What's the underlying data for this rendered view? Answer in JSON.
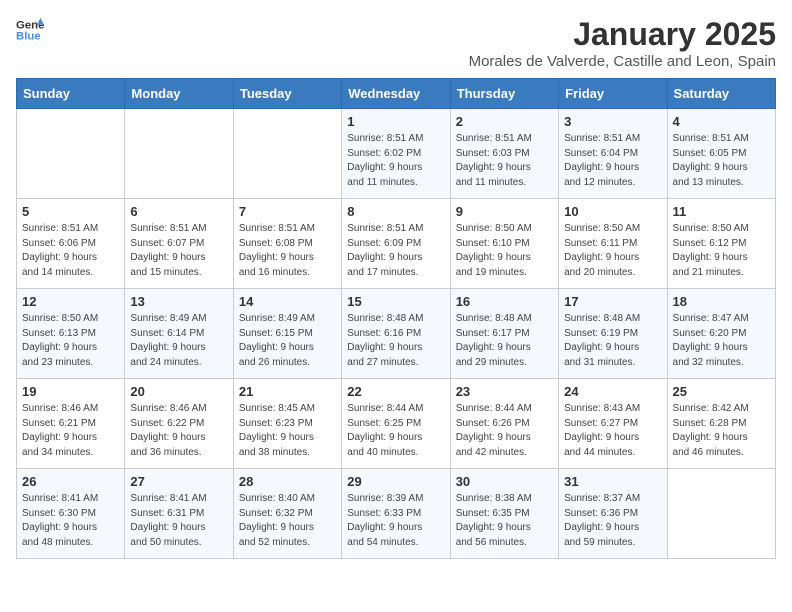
{
  "logo": {
    "general": "General",
    "blue": "Blue"
  },
  "title": "January 2025",
  "subtitle": "Morales de Valverde, Castille and Leon, Spain",
  "weekdays": [
    "Sunday",
    "Monday",
    "Tuesday",
    "Wednesday",
    "Thursday",
    "Friday",
    "Saturday"
  ],
  "weeks": [
    [
      {
        "day": "",
        "info": ""
      },
      {
        "day": "",
        "info": ""
      },
      {
        "day": "",
        "info": ""
      },
      {
        "day": "1",
        "info": "Sunrise: 8:51 AM\nSunset: 6:02 PM\nDaylight: 9 hours\nand 11 minutes."
      },
      {
        "day": "2",
        "info": "Sunrise: 8:51 AM\nSunset: 6:03 PM\nDaylight: 9 hours\nand 11 minutes."
      },
      {
        "day": "3",
        "info": "Sunrise: 8:51 AM\nSunset: 6:04 PM\nDaylight: 9 hours\nand 12 minutes."
      },
      {
        "day": "4",
        "info": "Sunrise: 8:51 AM\nSunset: 6:05 PM\nDaylight: 9 hours\nand 13 minutes."
      }
    ],
    [
      {
        "day": "5",
        "info": "Sunrise: 8:51 AM\nSunset: 6:06 PM\nDaylight: 9 hours\nand 14 minutes."
      },
      {
        "day": "6",
        "info": "Sunrise: 8:51 AM\nSunset: 6:07 PM\nDaylight: 9 hours\nand 15 minutes."
      },
      {
        "day": "7",
        "info": "Sunrise: 8:51 AM\nSunset: 6:08 PM\nDaylight: 9 hours\nand 16 minutes."
      },
      {
        "day": "8",
        "info": "Sunrise: 8:51 AM\nSunset: 6:09 PM\nDaylight: 9 hours\nand 17 minutes."
      },
      {
        "day": "9",
        "info": "Sunrise: 8:50 AM\nSunset: 6:10 PM\nDaylight: 9 hours\nand 19 minutes."
      },
      {
        "day": "10",
        "info": "Sunrise: 8:50 AM\nSunset: 6:11 PM\nDaylight: 9 hours\nand 20 minutes."
      },
      {
        "day": "11",
        "info": "Sunrise: 8:50 AM\nSunset: 6:12 PM\nDaylight: 9 hours\nand 21 minutes."
      }
    ],
    [
      {
        "day": "12",
        "info": "Sunrise: 8:50 AM\nSunset: 6:13 PM\nDaylight: 9 hours\nand 23 minutes."
      },
      {
        "day": "13",
        "info": "Sunrise: 8:49 AM\nSunset: 6:14 PM\nDaylight: 9 hours\nand 24 minutes."
      },
      {
        "day": "14",
        "info": "Sunrise: 8:49 AM\nSunset: 6:15 PM\nDaylight: 9 hours\nand 26 minutes."
      },
      {
        "day": "15",
        "info": "Sunrise: 8:48 AM\nSunset: 6:16 PM\nDaylight: 9 hours\nand 27 minutes."
      },
      {
        "day": "16",
        "info": "Sunrise: 8:48 AM\nSunset: 6:17 PM\nDaylight: 9 hours\nand 29 minutes."
      },
      {
        "day": "17",
        "info": "Sunrise: 8:48 AM\nSunset: 6:19 PM\nDaylight: 9 hours\nand 31 minutes."
      },
      {
        "day": "18",
        "info": "Sunrise: 8:47 AM\nSunset: 6:20 PM\nDaylight: 9 hours\nand 32 minutes."
      }
    ],
    [
      {
        "day": "19",
        "info": "Sunrise: 8:46 AM\nSunset: 6:21 PM\nDaylight: 9 hours\nand 34 minutes."
      },
      {
        "day": "20",
        "info": "Sunrise: 8:46 AM\nSunset: 6:22 PM\nDaylight: 9 hours\nand 36 minutes."
      },
      {
        "day": "21",
        "info": "Sunrise: 8:45 AM\nSunset: 6:23 PM\nDaylight: 9 hours\nand 38 minutes."
      },
      {
        "day": "22",
        "info": "Sunrise: 8:44 AM\nSunset: 6:25 PM\nDaylight: 9 hours\nand 40 minutes."
      },
      {
        "day": "23",
        "info": "Sunrise: 8:44 AM\nSunset: 6:26 PM\nDaylight: 9 hours\nand 42 minutes."
      },
      {
        "day": "24",
        "info": "Sunrise: 8:43 AM\nSunset: 6:27 PM\nDaylight: 9 hours\nand 44 minutes."
      },
      {
        "day": "25",
        "info": "Sunrise: 8:42 AM\nSunset: 6:28 PM\nDaylight: 9 hours\nand 46 minutes."
      }
    ],
    [
      {
        "day": "26",
        "info": "Sunrise: 8:41 AM\nSunset: 6:30 PM\nDaylight: 9 hours\nand 48 minutes."
      },
      {
        "day": "27",
        "info": "Sunrise: 8:41 AM\nSunset: 6:31 PM\nDaylight: 9 hours\nand 50 minutes."
      },
      {
        "day": "28",
        "info": "Sunrise: 8:40 AM\nSunset: 6:32 PM\nDaylight: 9 hours\nand 52 minutes."
      },
      {
        "day": "29",
        "info": "Sunrise: 8:39 AM\nSunset: 6:33 PM\nDaylight: 9 hours\nand 54 minutes."
      },
      {
        "day": "30",
        "info": "Sunrise: 8:38 AM\nSunset: 6:35 PM\nDaylight: 9 hours\nand 56 minutes."
      },
      {
        "day": "31",
        "info": "Sunrise: 8:37 AM\nSunset: 6:36 PM\nDaylight: 9 hours\nand 59 minutes."
      },
      {
        "day": "",
        "info": ""
      }
    ]
  ]
}
